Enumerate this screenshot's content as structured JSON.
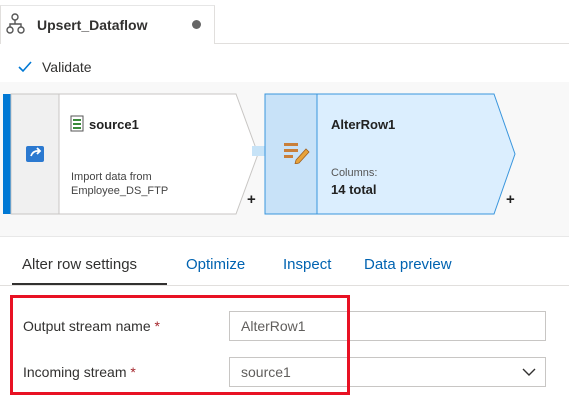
{
  "tab": {
    "title": "Upsert_Dataflow"
  },
  "toolbar": {
    "validate_label": "Validate"
  },
  "canvas": {
    "source": {
      "name": "source1",
      "line1": "Import data from",
      "line2": "Employee_DS_FTP"
    },
    "alter": {
      "name": "AlterRow1",
      "columns_label": "Columns:",
      "columns_value": "14 total"
    },
    "plus": "+"
  },
  "settings": {
    "tabs": [
      "Alter row settings",
      "Optimize",
      "Inspect",
      "Data preview"
    ],
    "output_label": "Output stream name",
    "output_value": "AlterRow1",
    "incoming_label": "Incoming stream",
    "incoming_value": "source1",
    "required_mark": "*"
  },
  "colors": {
    "accent": "#0078d4",
    "node_selected": "#dbeefe",
    "highlight": "#e81123"
  }
}
